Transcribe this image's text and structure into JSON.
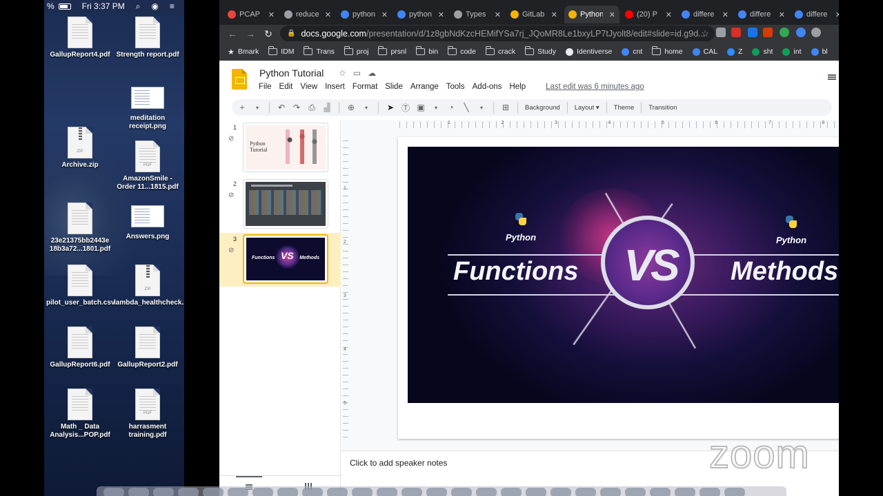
{
  "menubar": {
    "clock": "Fri 3:37 PM",
    "percent": "%"
  },
  "desktop_icons": [
    {
      "label": "GallupReport4.pdf",
      "kind": "doc"
    },
    {
      "label": "Strength report.pdf",
      "kind": "doc"
    },
    {
      "label": "meditation receipt.png",
      "kind": "png"
    },
    {
      "label": "Archive.zip",
      "kind": "zip",
      "tag": "ZIP"
    },
    {
      "label": "AmazonSmile - Order 11...1815.pdf",
      "kind": "doc",
      "tag": "PDF"
    },
    {
      "label": "23e21375bb2443e 18b3a72...1801.pdf",
      "kind": "doc"
    },
    {
      "label": "Answers.png",
      "kind": "png"
    },
    {
      "label": "pilot_user_batch.csv",
      "kind": "doc"
    },
    {
      "label": "lambda_healthcheck.zip",
      "kind": "zip",
      "tag": "ZIP"
    },
    {
      "label": "GallupReport6.pdf",
      "kind": "doc"
    },
    {
      "label": "GallupReport2.pdf",
      "kind": "doc"
    },
    {
      "label": "Math _ Data Analysis...POP.pdf",
      "kind": "doc"
    },
    {
      "label": "harrasment training.pdf",
      "kind": "doc",
      "tag": "PDF"
    }
  ],
  "tabs": [
    {
      "title": "PCAP",
      "favicon": "#e8453c"
    },
    {
      "title": "reduce",
      "favicon": "#9aa0a6"
    },
    {
      "title": "python",
      "favicon": "#4285f4"
    },
    {
      "title": "python",
      "favicon": "#4285f4"
    },
    {
      "title": "Types",
      "favicon": "#9aa0a6"
    },
    {
      "title": "GitLab",
      "favicon": "#f4b400"
    },
    {
      "title": "Python",
      "favicon": "#f4b400"
    },
    {
      "title": "(20) P",
      "favicon": "#ff0000"
    },
    {
      "title": "differe",
      "favicon": "#4285f4"
    },
    {
      "title": "differe",
      "favicon": "#4285f4"
    },
    {
      "title": "differe",
      "favicon": "#4285f4"
    }
  ],
  "omnibox": {
    "host": "docs.google.com",
    "path": "/presentation/d/1z8gbNdKzcHEMifYSa7rj_JQoMR8Le1bxyLP7tJyolt8/edit#slide=id.g9d..."
  },
  "bookmarks": [
    {
      "label": "Bmark",
      "icon": "star"
    },
    {
      "label": "IDM",
      "icon": "folder"
    },
    {
      "label": "Trans",
      "icon": "folder"
    },
    {
      "label": "proj",
      "icon": "folder"
    },
    {
      "label": "prsnl",
      "icon": "folder"
    },
    {
      "label": "bin",
      "icon": "folder"
    },
    {
      "label": "code",
      "icon": "folder"
    },
    {
      "label": "crack",
      "icon": "folder"
    },
    {
      "label": "Study",
      "icon": "folder"
    },
    {
      "label": "Identiverse",
      "icon": "dot"
    },
    {
      "label": "cnt",
      "icon": "dot"
    },
    {
      "label": "home",
      "icon": "folder"
    },
    {
      "label": "CAL",
      "icon": "dot"
    },
    {
      "label": "Z",
      "icon": "dot"
    },
    {
      "label": "sht",
      "icon": "dot"
    },
    {
      "label": "int",
      "icon": "dot"
    },
    {
      "label": "bl",
      "icon": "dot"
    }
  ],
  "app": {
    "title": "Python Tutorial",
    "menus": [
      "File",
      "Edit",
      "View",
      "Insert",
      "Format",
      "Slide",
      "Arrange",
      "Tools",
      "Add-ons",
      "Help"
    ],
    "last_edit": "Last edit was 6 minutes ago",
    "toolbar": {
      "background": "Background",
      "layout": "Layout",
      "theme": "Theme",
      "transition": "Transition"
    },
    "notes_placeholder": "Click to add speaker notes"
  },
  "filmstrip": [
    {
      "num": "1",
      "title": "Python Tutorial"
    },
    {
      "num": "2"
    },
    {
      "num": "3",
      "left": "Functions",
      "vs": "VS",
      "right": "Methods"
    }
  ],
  "ruler_top": [
    "1",
    "2",
    "3",
    "4",
    "5",
    "6",
    "7",
    "8"
  ],
  "ruler_left": [
    "1",
    "2",
    "3",
    "4",
    "5"
  ],
  "slide": {
    "left_logo_label": "Python",
    "right_logo_label": "Python",
    "left_word": "Functions",
    "vs": "VS",
    "right_word": "Methods"
  },
  "watermark": "zoom"
}
